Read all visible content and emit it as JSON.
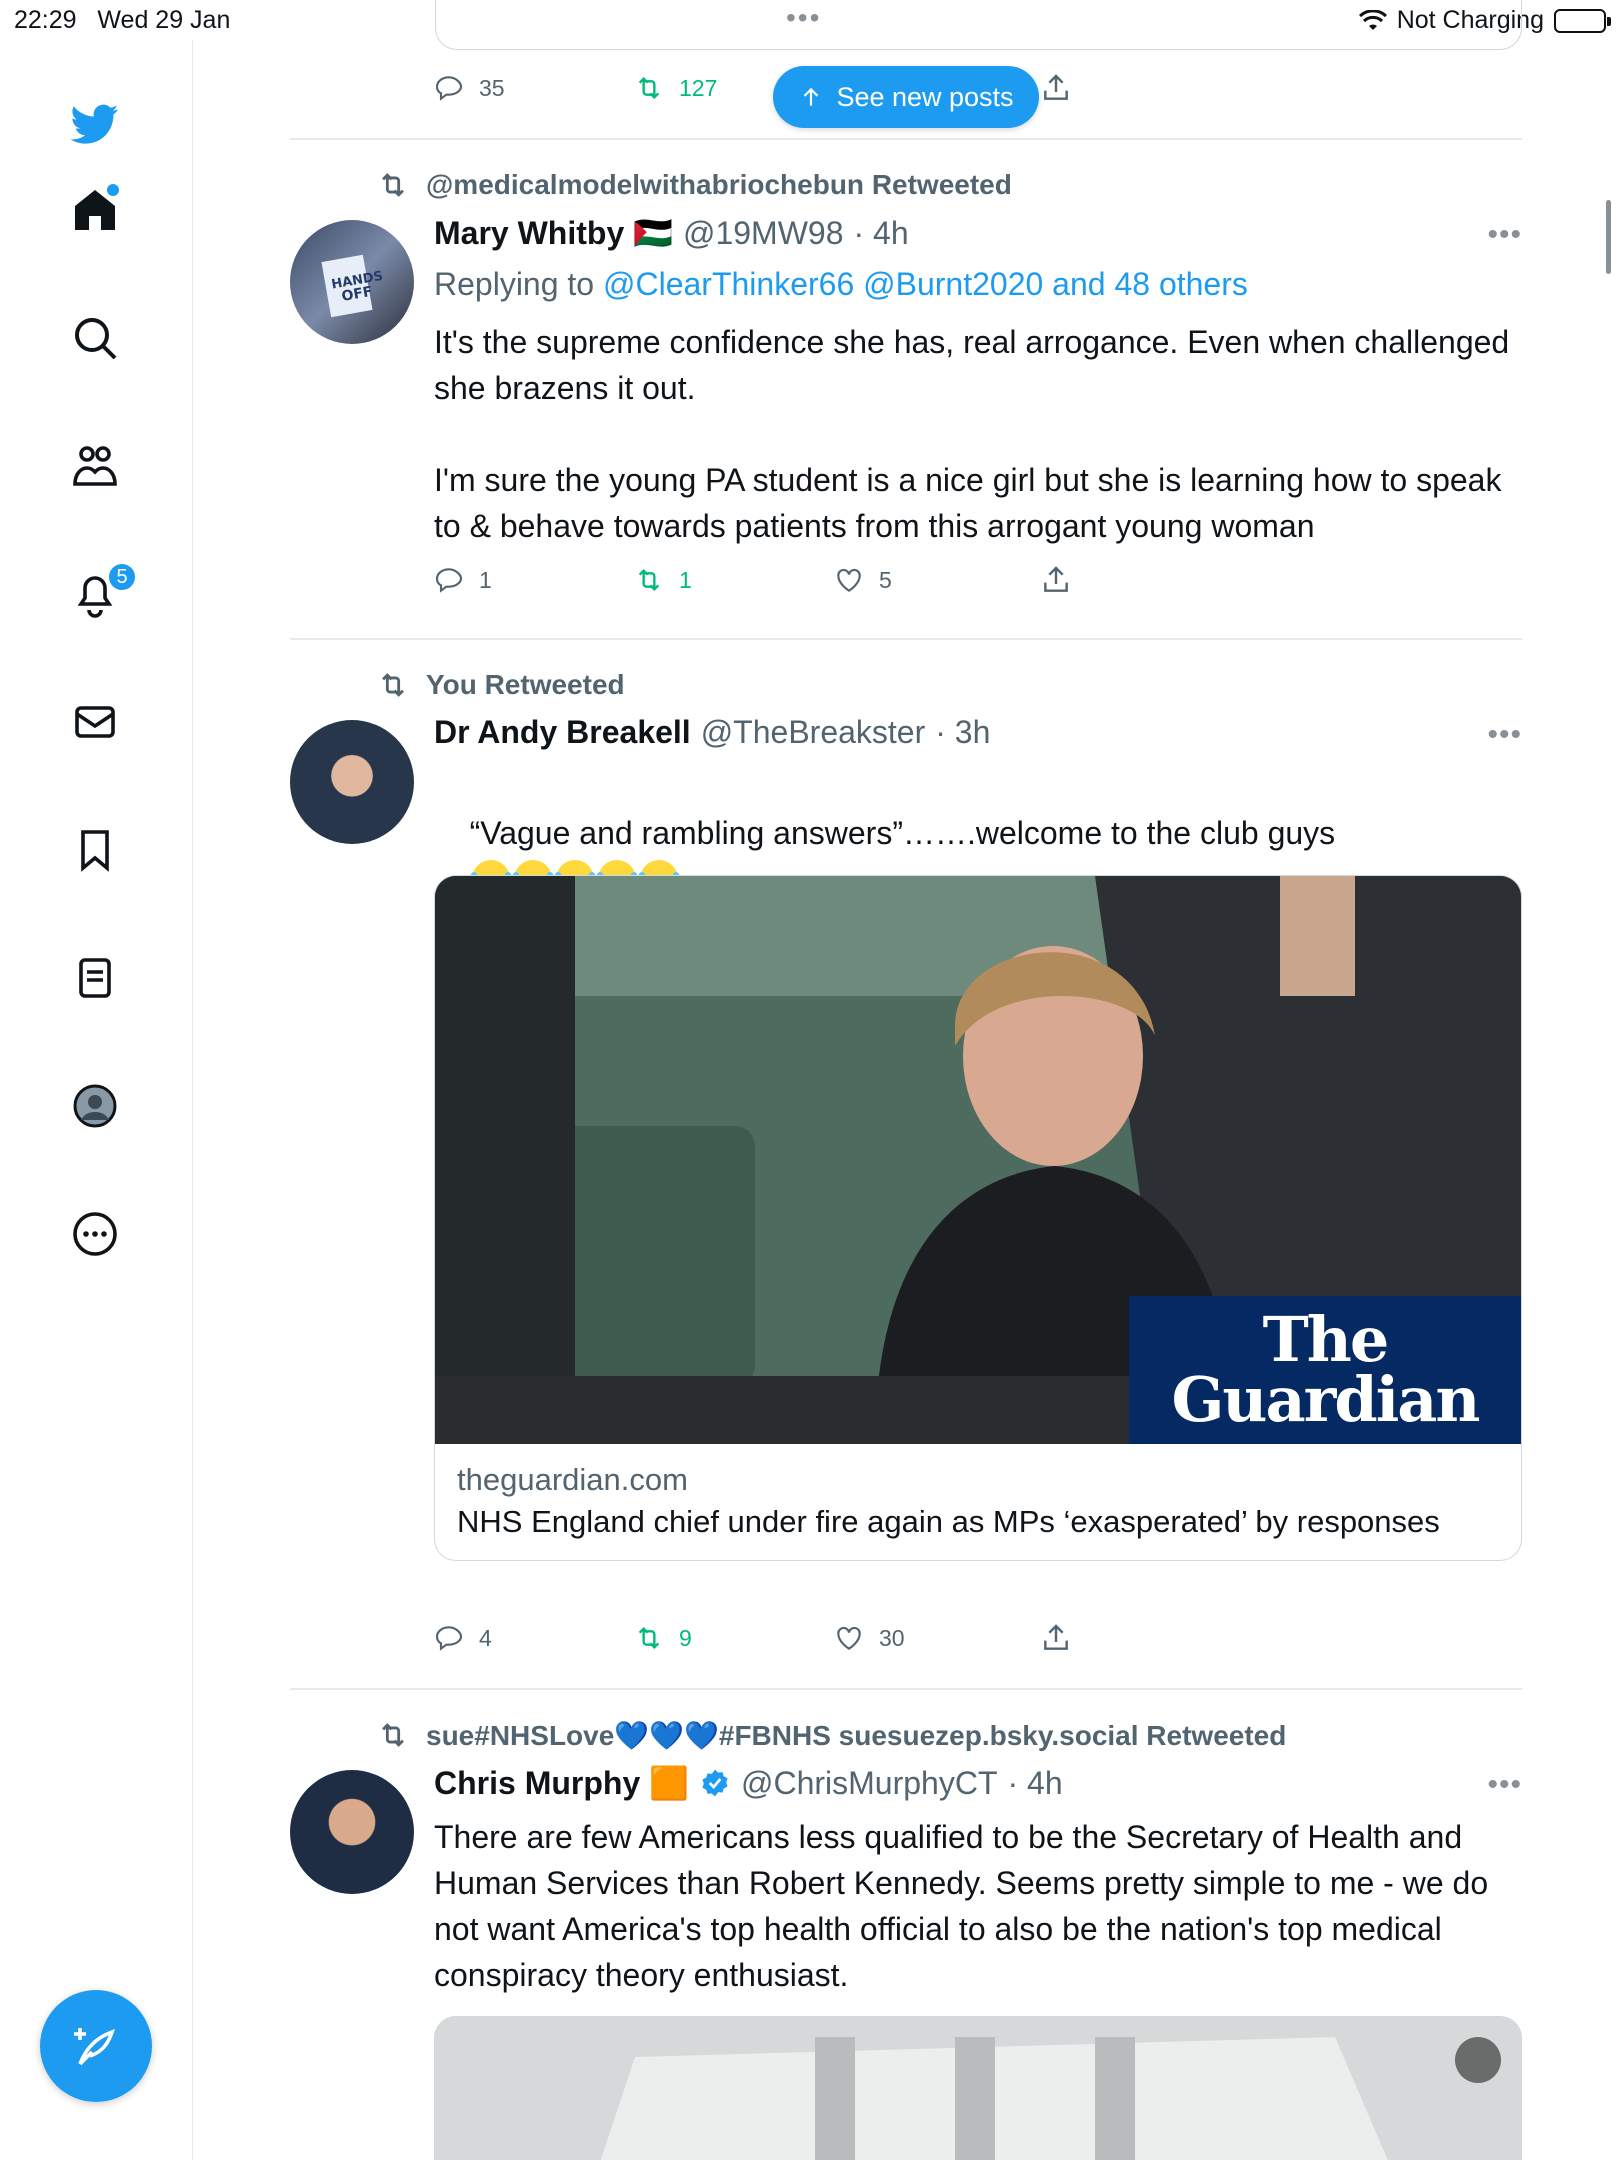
{
  "status_bar": {
    "time": "22:29",
    "date": "Wed 29 Jan",
    "charging": "Not Charging"
  },
  "sidebar": {
    "items": [
      {
        "name": "twitter-logo"
      },
      {
        "name": "home"
      },
      {
        "name": "search"
      },
      {
        "name": "communities"
      },
      {
        "name": "notifications",
        "badge": "5"
      },
      {
        "name": "messages"
      },
      {
        "name": "bookmarks"
      },
      {
        "name": "lists"
      },
      {
        "name": "profile"
      },
      {
        "name": "more"
      }
    ],
    "compose_label": "Post",
    "accent": "#1d9bf0"
  },
  "top_partial_tweet": {
    "replies": "35",
    "retweets": "127"
  },
  "see_new_posts": "See new posts",
  "tweets": [
    {
      "social": "@medicalmodelwithabriochebun Retweeted",
      "name": "Mary Whitby 🇵🇸",
      "handle": "@19MW98",
      "time": "· 4h",
      "reply_prefix": "Replying to ",
      "reply_links": "@ClearThinker66 @Burnt2020 and 48 others",
      "text": "It's the supreme confidence she has, real arrogance. Even when challenged she brazens it out.\n\nI'm sure the young PA student is a nice girl but she is learning how to speak to & behave towards patients from this arrogant young woman",
      "replies": "1",
      "retweets": "1",
      "likes": "5"
    },
    {
      "social": "You Retweeted",
      "name": "Dr Andy Breakell",
      "handle": "@TheBreakster",
      "time": "· 3h",
      "text": "“Vague and rambling answers”…….welcome to the club guys",
      "card_domain": "theguardian.com",
      "card_title": "NHS England chief under fire again as MPs ‘exasperated’ by responses",
      "card_brand_line1": "The",
      "card_brand_line2": "Guardian",
      "replies": "4",
      "retweets": "9",
      "likes": "30"
    },
    {
      "social": "sue#NHSLove💙💙💙#FBNHS suesuezep.bsky.social Retweeted",
      "name": "Chris Murphy 🟧",
      "handle": "@ChrisMurphyCT",
      "time": "· 4h",
      "text": "There are few Americans less qualified to be the Secretary of Health and Human Services than Robert Kennedy. Seems pretty simple to me - we do not want America's top health official to also be the nation's top medical conspiracy theory enthusiast."
    }
  ]
}
